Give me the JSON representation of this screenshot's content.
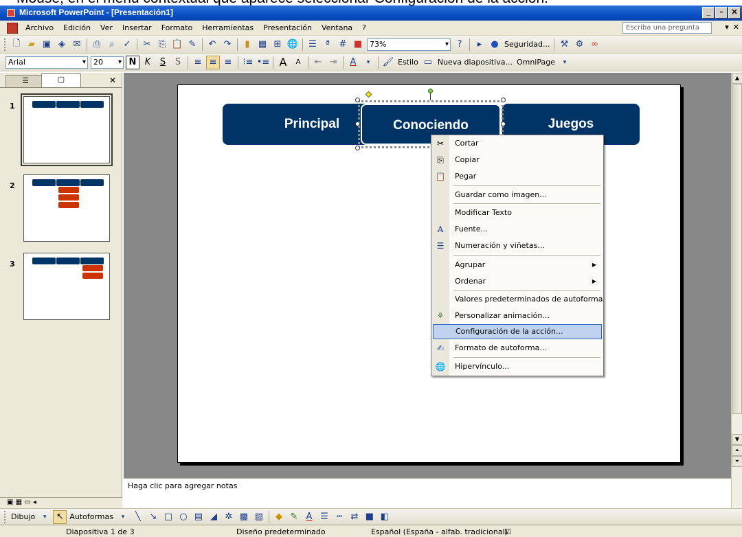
{
  "caption": "Mouse, en el menú contextual que aparece seleccionar Configuración de la acción.",
  "window": {
    "title": "Microsoft PowerPoint - [Presentación1]",
    "controls": [
      "_",
      "▫",
      "✕"
    ]
  },
  "menubar": {
    "items": [
      "Archivo",
      "Edición",
      "Ver",
      "Insertar",
      "Formato",
      "Herramientas",
      "Presentación",
      "Ventana",
      "?"
    ],
    "ask_placeholder": "Escriba una pregunta",
    "close_glyph": "✕"
  },
  "toolbar_standard": {
    "zoom": "73%",
    "help_glyph": "?",
    "security_label": "Seguridad..."
  },
  "toolbar_format": {
    "font": "Arial",
    "size": "20",
    "bold": "N",
    "italic": "K",
    "underline": "S",
    "shadow": "S",
    "grow_font": "A",
    "shrink_font": "A",
    "font_color": "A",
    "style_label": "Estilo",
    "new_slide_label": "Nueva diapositiva...",
    "omnipage_label": "OmniPage"
  },
  "slides_pane": {
    "tab_outline": "☰",
    "tab_slides": "▢",
    "close": "✕",
    "numbers": [
      "1",
      "2",
      "3"
    ]
  },
  "slide": {
    "buttons": [
      "Principal",
      "Conociendo",
      "Juegos"
    ]
  },
  "context_menu": {
    "items": [
      {
        "label": "Cortar",
        "icon": "scissors-icon"
      },
      {
        "label": "Copiar",
        "icon": "copy-icon"
      },
      {
        "label": "Pegar",
        "icon": "paste-icon"
      },
      {
        "label": "Guardar como imagen..."
      },
      {
        "label": "Modificar Texto"
      },
      {
        "label": "Fuente...",
        "icon": "font-icon"
      },
      {
        "label": "Numeración y viñetas...",
        "icon": "bullets-icon"
      },
      {
        "label": "Agrupar",
        "submenu": true
      },
      {
        "label": "Ordenar",
        "submenu": true
      },
      {
        "label": "Valores predeterminados de autoforma"
      },
      {
        "label": "Personalizar animación...",
        "icon": "animation-icon"
      },
      {
        "label": "Configuración de la acción...",
        "highlighted": true
      },
      {
        "label": "Formato de autoforma...",
        "icon": "format-icon"
      },
      {
        "label": "Hipervínculo...",
        "icon": "hyperlink-icon"
      }
    ]
  },
  "notes_placeholder": "Haga clic para agregar notas",
  "drawing_toolbar": {
    "draw_label": "Dibujo",
    "autoshapes_label": "Autoformas",
    "font_color_glyph": "A"
  },
  "statusbar": {
    "slide_info": "Diapositiva 1 de 3",
    "design": "Diseño predeterminado",
    "language": "Español (España - alfab. tradicional)"
  },
  "colors": {
    "nav_button": "#003366",
    "sub_button": "#cc3300",
    "menu_highlight": "#c1d2ee",
    "titlebar": "#0a4fc4"
  }
}
